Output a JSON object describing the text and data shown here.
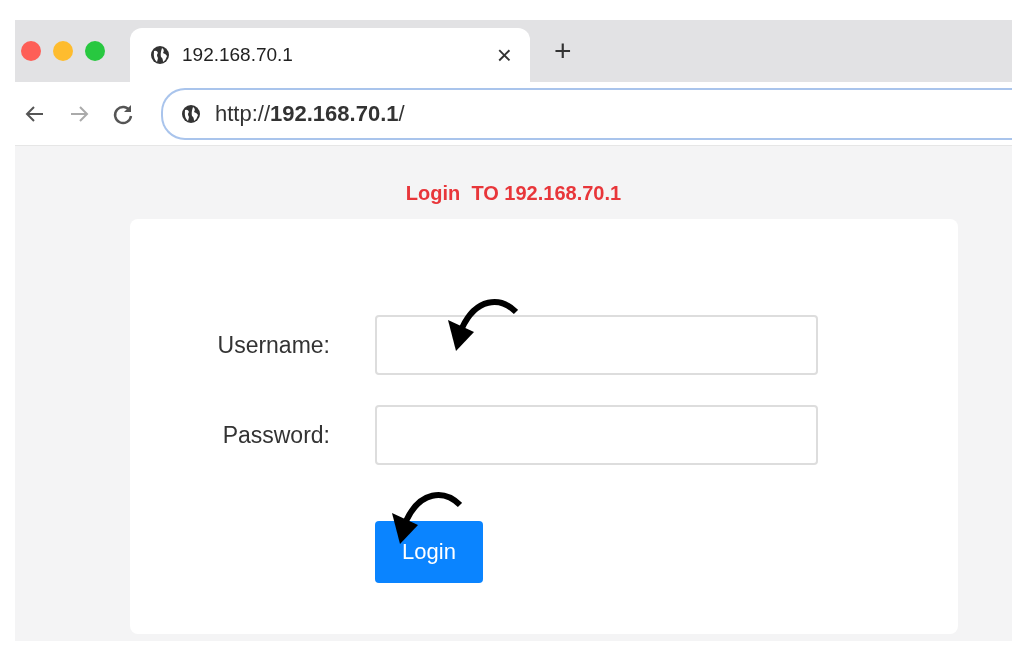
{
  "window": {
    "controls": [
      {
        "color": "#fe5f57"
      },
      {
        "color": "#febc2e"
      },
      {
        "color": "#28c840"
      }
    ]
  },
  "tab": {
    "title": "192.168.70.1",
    "close": "×",
    "selected": true
  },
  "new_tab": "+",
  "address_bar": {
    "url": "http://**192.168.70.1**/"
  },
  "page": {
    "title": "Login  TO 192.168.70.1",
    "fields": [
      {
        "label": "Username:"
      },
      {
        "label": "Password:"
      }
    ],
    "button": "Login"
  }
}
